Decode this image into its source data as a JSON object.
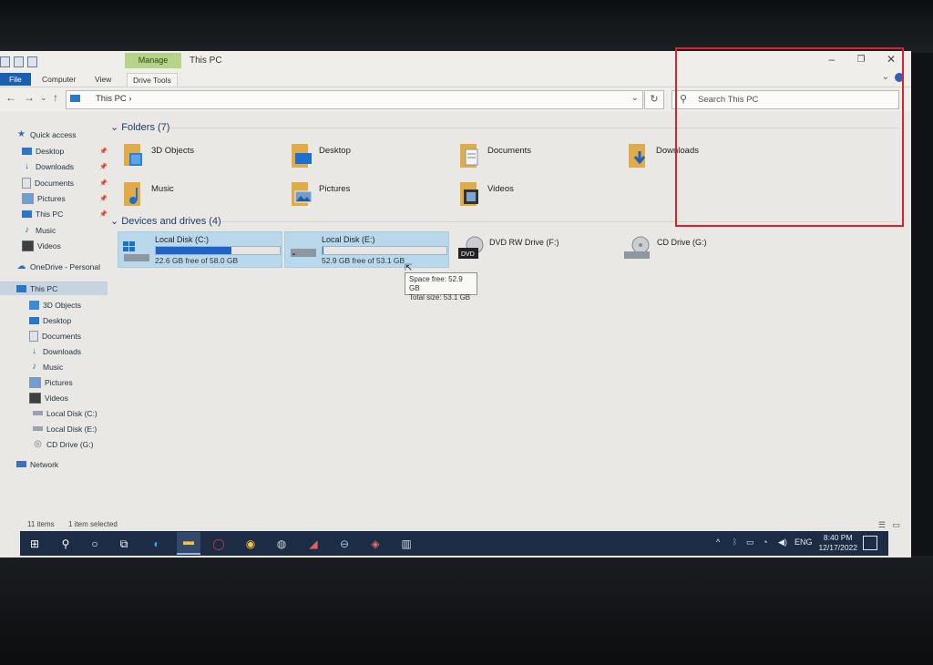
{
  "window": {
    "title": "This PC",
    "manage_tab": "Manage",
    "controls": {
      "minimize": "–",
      "restore": "❐",
      "close": "✕"
    }
  },
  "ribbon": {
    "tabs": [
      "File",
      "Computer",
      "View",
      "Drive Tools"
    ],
    "expand": "⌄"
  },
  "address": {
    "back": "←",
    "forward": "→",
    "recent": "⌄",
    "up": "↑",
    "breadcrumb": "This PC  ›",
    "dropdown": "⌄",
    "refresh": "↻",
    "search_placeholder": "Search This PC",
    "search_icon": "⚲"
  },
  "sidebar": {
    "quick_access": "Quick access",
    "quick_items": [
      {
        "label": "Desktop",
        "icon": "desktop-icon",
        "pinned": true
      },
      {
        "label": "Downloads",
        "icon": "download-arrow-icon",
        "pinned": true
      },
      {
        "label": "Documents",
        "icon": "document-icon",
        "pinned": true
      },
      {
        "label": "Pictures",
        "icon": "picture-icon",
        "pinned": true
      },
      {
        "label": "This PC",
        "icon": "monitor-icon",
        "pinned": true
      },
      {
        "label": "Music",
        "icon": "music-note-icon",
        "pinned": false
      },
      {
        "label": "Videos",
        "icon": "video-icon",
        "pinned": false
      }
    ],
    "onedrive": "OneDrive - Personal",
    "this_pc": "This PC",
    "pc_items": [
      {
        "label": "3D Objects",
        "icon": "cube-icon"
      },
      {
        "label": "Desktop",
        "icon": "desktop-icon"
      },
      {
        "label": "Documents",
        "icon": "document-icon"
      },
      {
        "label": "Downloads",
        "icon": "download-arrow-icon"
      },
      {
        "label": "Music",
        "icon": "music-note-icon"
      },
      {
        "label": "Pictures",
        "icon": "picture-icon"
      },
      {
        "label": "Videos",
        "icon": "video-icon"
      },
      {
        "label": "Local Disk (C:)",
        "icon": "drive-icon"
      },
      {
        "label": "Local Disk (E:)",
        "icon": "drive-icon"
      },
      {
        "label": "CD Drive (G:)",
        "icon": "cd-icon"
      }
    ],
    "network": "Network"
  },
  "content": {
    "folders_heading": "Folders (7)",
    "folders": [
      {
        "label": "3D Objects",
        "icon": "3d-objects-folder-icon"
      },
      {
        "label": "Desktop",
        "icon": "desktop-folder-icon"
      },
      {
        "label": "Documents",
        "icon": "documents-folder-icon"
      },
      {
        "label": "Downloads",
        "icon": "downloads-folder-icon"
      },
      {
        "label": "Music",
        "icon": "music-folder-icon"
      },
      {
        "label": "Pictures",
        "icon": "pictures-folder-icon"
      },
      {
        "label": "Videos",
        "icon": "videos-folder-icon"
      }
    ],
    "devices_heading": "Devices and drives (4)",
    "drives": [
      {
        "label": "Local Disk (C:)",
        "free": "22.6 GB free of 58.0 GB",
        "used_fraction": 0.61,
        "selected": true
      },
      {
        "label": "Local Disk (E:)",
        "free": "52.9 GB free of 53.1 GB",
        "used_fraction": 0.004,
        "selected": true
      },
      {
        "label": "DVD RW Drive (F:)",
        "free": "",
        "used_fraction": null,
        "selected": false
      },
      {
        "label": "CD Drive (G:)",
        "free": "",
        "used_fraction": null,
        "selected": false
      }
    ],
    "tooltip": {
      "space_free": "Space free: 52.9 GB",
      "total_size": "Total size: 53.1 GB"
    }
  },
  "status": {
    "items": "11 items",
    "selected": "1 item selected"
  },
  "taskbar": {
    "tray": {
      "chevron": "^",
      "language": "ENG"
    },
    "time": "8:40 PM",
    "date": "12/17/2022"
  },
  "colors": {
    "accent": "#1d63c9",
    "selection": "#b9d8ec",
    "annotation": "#d9232c",
    "taskbar": "#1c2c44"
  }
}
